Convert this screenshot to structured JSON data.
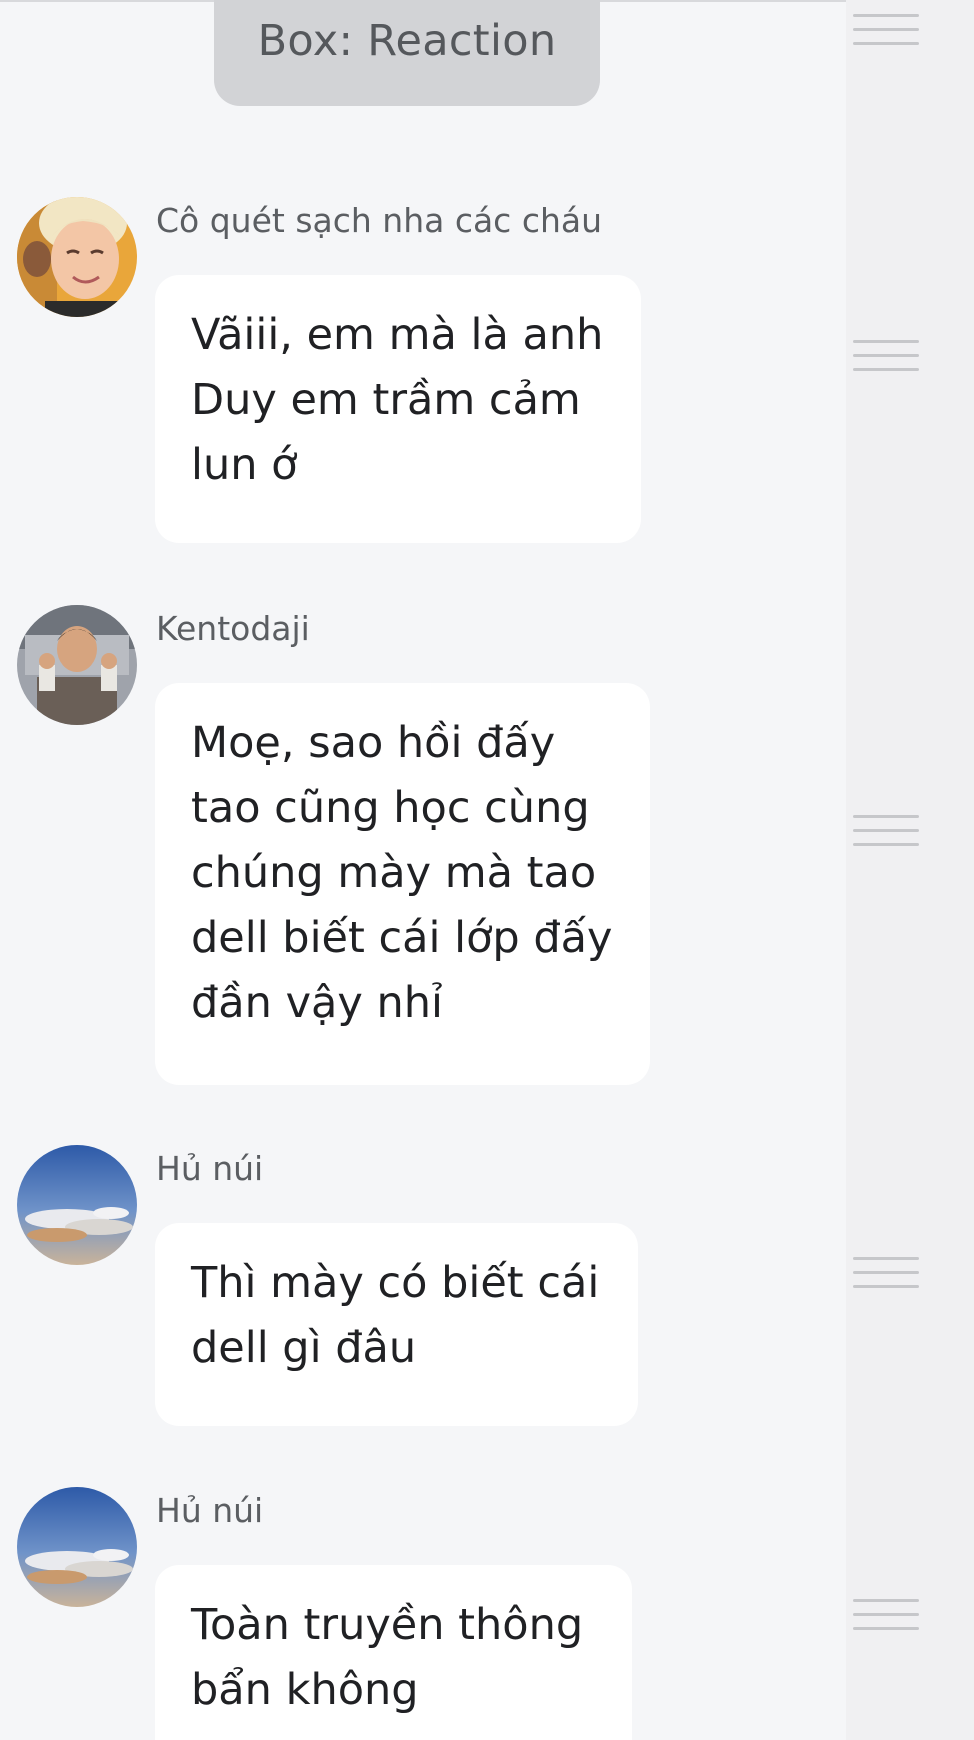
{
  "header": {
    "title": "Box: Reaction"
  },
  "messages": [
    {
      "sender": "Cô quét sạch nha các cháu",
      "avatar": "blonde-person-avatar",
      "text": "Vãiii, em mà là anh\nDuy em trầm cảm\nlun ớ"
    },
    {
      "sender": "Kentodaji",
      "avatar": "boy-holding-items-avatar",
      "text": "Moẹ, sao hồi đấy\ntao cũng học cùng\nchúng mày mà tao\ndell biết cái lớp đấy\nđần vậy nhỉ"
    },
    {
      "sender": "Hủ núi",
      "avatar": "sky-clouds-avatar",
      "text": "Thì mày có biết cái\ndell gì đâu"
    },
    {
      "sender": "Hủ núi",
      "avatar": "sky-clouds-avatar",
      "text": "Toàn truyền thông\nbẩn không"
    }
  ],
  "icons": {
    "menu": "hamburger-menu-icon"
  },
  "colors": {
    "background": "#f5f6f8",
    "bubble": "#ffffff",
    "header_box": "#d2d3d6",
    "rail": "#f0f0f2"
  }
}
